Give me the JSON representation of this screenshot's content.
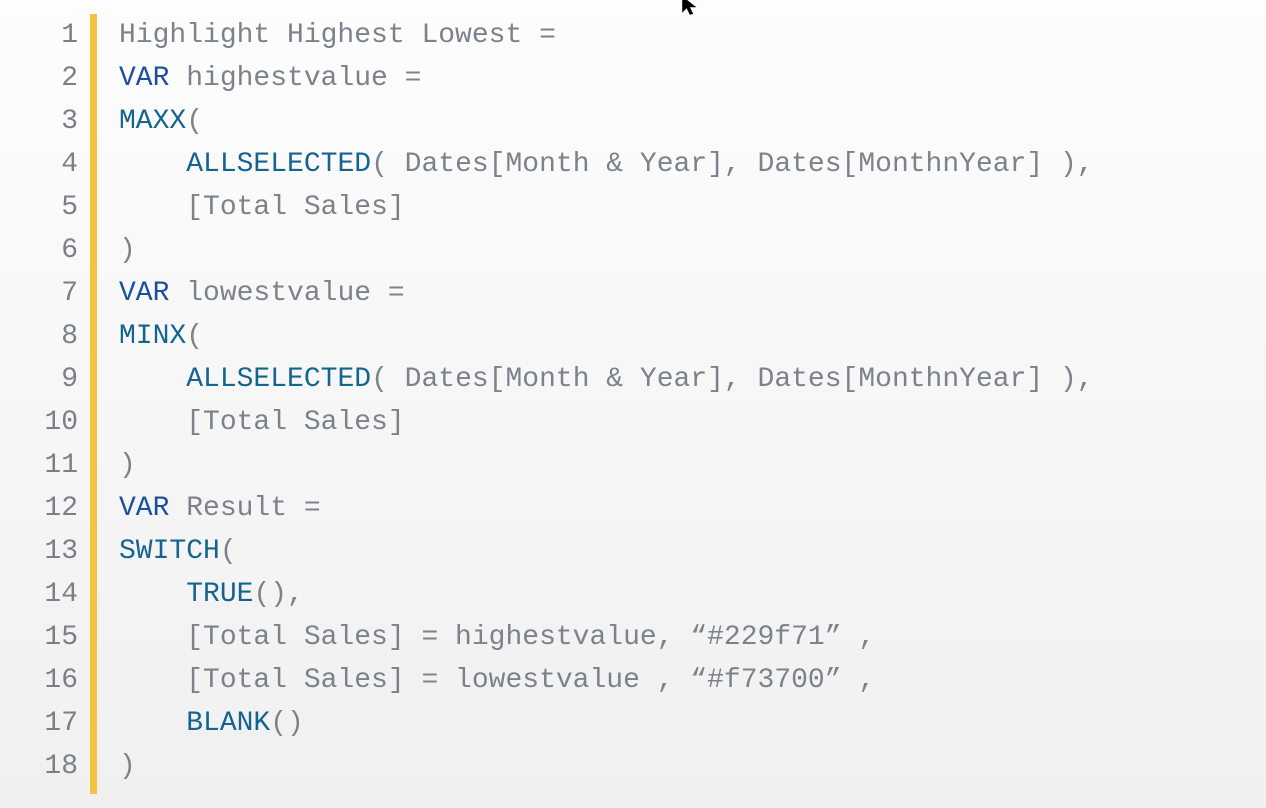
{
  "lines": [
    {
      "n": "1",
      "tokens": [
        {
          "c": "txt",
          "t": "Highlight Highest Lowest ="
        }
      ]
    },
    {
      "n": "2",
      "tokens": [
        {
          "c": "kw",
          "t": "VAR"
        },
        {
          "c": "txt",
          "t": " highestvalue ="
        }
      ]
    },
    {
      "n": "3",
      "tokens": [
        {
          "c": "fn",
          "t": "MAXX"
        },
        {
          "c": "txt",
          "t": "("
        }
      ]
    },
    {
      "n": "4",
      "tokens": [
        {
          "c": "txt",
          "t": "    "
        },
        {
          "c": "fn",
          "t": "ALLSELECTED"
        },
        {
          "c": "txt",
          "t": "( Dates[Month & Year], Dates[MonthnYear] ),"
        }
      ]
    },
    {
      "n": "5",
      "tokens": [
        {
          "c": "txt",
          "t": "    [Total Sales]"
        }
      ]
    },
    {
      "n": "6",
      "tokens": [
        {
          "c": "txt",
          "t": ")"
        }
      ]
    },
    {
      "n": "7",
      "tokens": [
        {
          "c": "kw",
          "t": "VAR"
        },
        {
          "c": "txt",
          "t": " lowestvalue ="
        }
      ]
    },
    {
      "n": "8",
      "tokens": [
        {
          "c": "fn",
          "t": "MINX"
        },
        {
          "c": "txt",
          "t": "("
        }
      ]
    },
    {
      "n": "9",
      "tokens": [
        {
          "c": "txt",
          "t": "    "
        },
        {
          "c": "fn",
          "t": "ALLSELECTED"
        },
        {
          "c": "txt",
          "t": "( Dates[Month & Year], Dates[MonthnYear] ),"
        }
      ]
    },
    {
      "n": "10",
      "tokens": [
        {
          "c": "txt",
          "t": "    [Total Sales]"
        }
      ]
    },
    {
      "n": "11",
      "tokens": [
        {
          "c": "txt",
          "t": ")"
        }
      ]
    },
    {
      "n": "12",
      "tokens": [
        {
          "c": "kw",
          "t": "VAR"
        },
        {
          "c": "txt",
          "t": " Result ="
        }
      ]
    },
    {
      "n": "13",
      "tokens": [
        {
          "c": "fn",
          "t": "SWITCH"
        },
        {
          "c": "txt",
          "t": "("
        }
      ]
    },
    {
      "n": "14",
      "tokens": [
        {
          "c": "txt",
          "t": "    "
        },
        {
          "c": "fn",
          "t": "TRUE"
        },
        {
          "c": "txt",
          "t": "(),"
        }
      ]
    },
    {
      "n": "15",
      "tokens": [
        {
          "c": "txt",
          "t": "    [Total Sales] = highestvalue, “#229f71” ,"
        }
      ]
    },
    {
      "n": "16",
      "tokens": [
        {
          "c": "txt",
          "t": "    [Total Sales] = lowestvalue , “#f73700” ,"
        }
      ]
    },
    {
      "n": "17",
      "tokens": [
        {
          "c": "txt",
          "t": "    "
        },
        {
          "c": "fn",
          "t": "BLANK"
        },
        {
          "c": "txt",
          "t": "()"
        }
      ]
    },
    {
      "n": "18",
      "tokens": [
        {
          "c": "txt",
          "t": ")"
        }
      ]
    }
  ]
}
